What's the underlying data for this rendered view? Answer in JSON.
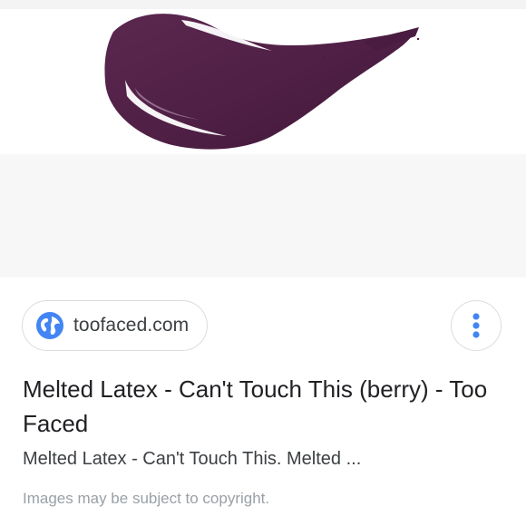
{
  "image": {
    "alt": "Melted Latex - Can't Touch This (berry) - Too Faced",
    "swatch_color": "#4f1f45",
    "background_color": "#f7f7f7"
  },
  "source": {
    "domain": "toofaced.com",
    "icon": "globe-icon",
    "icon_color": "#4285f4"
  },
  "menu": {
    "icon": "more-vert-icon",
    "icon_color": "#4285f4"
  },
  "result": {
    "title": "Melted Latex - Can't Touch This (berry) - Too Faced",
    "snippet": "Melted Latex - Can't Touch This. Melted ..."
  },
  "footer": {
    "copyright_note": "Images may be subject to copyright."
  }
}
